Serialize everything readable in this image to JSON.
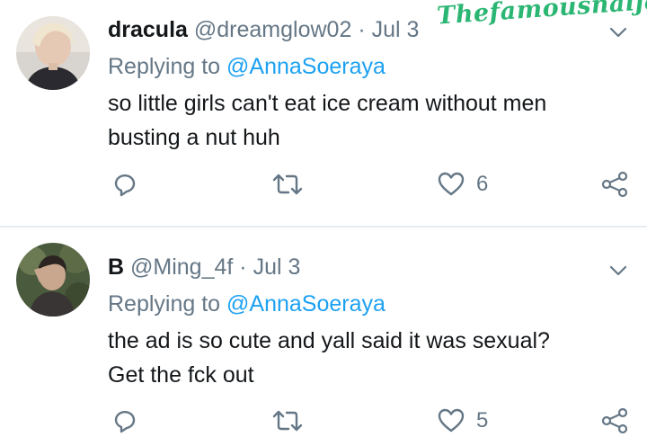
{
  "watermark": "Thefamousnaija",
  "tweets": [
    {
      "display_name": "dracula",
      "handle": "@dreamglow02",
      "separator": "·",
      "date": "Jul 3",
      "replying_to_prefix": "Replying to",
      "replying_to_handle": "@AnnaSoeraya",
      "text_lines": [
        "so little girls can't eat ice cream without men",
        "busting a nut huh"
      ],
      "like_count": "6",
      "avatar_icon": "avatar-photo-person"
    },
    {
      "display_name": "B",
      "handle": "@Ming_4f",
      "separator": "·",
      "date": "Jul 3",
      "replying_to_prefix": "Replying to",
      "replying_to_handle": "@AnnaSoeraya",
      "text_lines": [
        "the ad is so cute and yall said it was sexual?",
        "Get the fck out"
      ],
      "like_count": "5",
      "avatar_icon": "avatar-photo-person"
    }
  ],
  "icons": {
    "reply": "reply-icon",
    "retweet": "retweet-icon",
    "like": "heart-icon",
    "share": "share-icon",
    "menu": "chevron-down-icon"
  },
  "colors": {
    "text": "#14171a",
    "secondary": "#657786",
    "accent": "#1da1f2",
    "watermark": "#2bb673",
    "divider": "#e6ecf0"
  }
}
